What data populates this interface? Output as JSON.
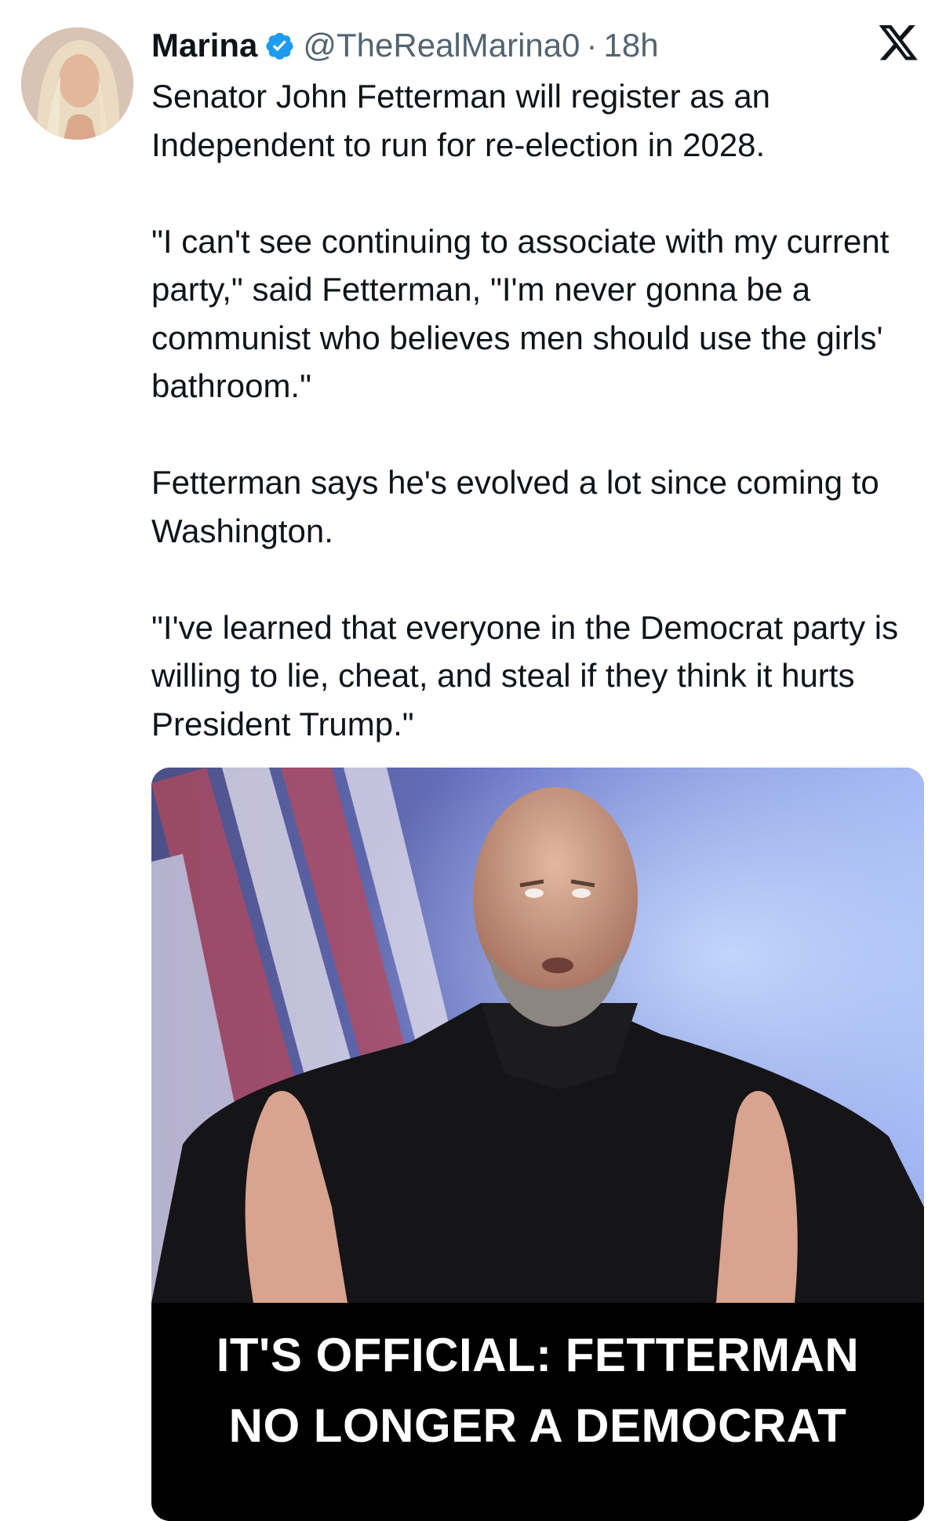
{
  "tweet": {
    "author_name": "Marina",
    "handle": "@TheRealMarina0",
    "separator": "·",
    "time": "18h",
    "paragraphs": [
      "Senator John Fetterman will register as an Independent to run for re-election in 2028.",
      "\"I can't see continuing to associate with my current party,\" said Fetterman, \"I'm never gonna be a communist who believes men should use the girls' bathroom.\"",
      "Fetterman says he's evolved a lot since coming to Washington.",
      "\"I've learned that everyone in the Democrat party is willing to lie, cheat, and steal if they think it hurts President Trump.\""
    ],
    "media": {
      "caption_line1": "IT'S OFFICIAL: FETTERMAN",
      "caption_line2": "NO LONGER A DEMOCRAT"
    }
  },
  "icons": {
    "verified": "verified-badge-icon",
    "platform": "x-logo-icon"
  },
  "colors": {
    "verified_blue": "#1d9bf0",
    "secondary_text": "#536471",
    "primary_text": "#0f1419"
  }
}
